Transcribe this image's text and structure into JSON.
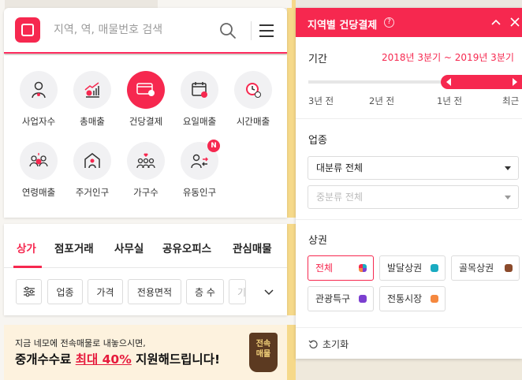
{
  "search": {
    "placeholder": "지역, 역, 매물번호 검색"
  },
  "categories": [
    {
      "label": "사업자수",
      "icon": "person-icon"
    },
    {
      "label": "총매출",
      "icon": "sales-chart-icon"
    },
    {
      "label": "건당결제",
      "icon": "card-payment-icon"
    },
    {
      "label": "요일매출",
      "icon": "calendar-icon"
    },
    {
      "label": "시간매출",
      "icon": "clock-icon"
    },
    {
      "label": "연령매출",
      "icon": "age-group-icon"
    },
    {
      "label": "주거인구",
      "icon": "house-person-icon"
    },
    {
      "label": "가구수",
      "icon": "household-icon"
    },
    {
      "label": "유동인구",
      "icon": "floating-population-icon",
      "badge": "N"
    }
  ],
  "tabs": [
    "상가",
    "점포거래",
    "사무실",
    "공유오피스",
    "관심매물"
  ],
  "filters": [
    "업종",
    "가격",
    "전용면적",
    "층 수",
    "기"
  ],
  "banner": {
    "line1": "지금 네모에 전속매물로 내놓으시면,",
    "line2_prefix": "중개수수료 ",
    "line2_highlight": "최대 40%",
    "line2_suffix": " 지원해드립니다!",
    "stamp": "전속\n매물"
  },
  "panel": {
    "title": "지역별 건당결제",
    "help": "?",
    "period_label": "기간",
    "period_range": "2018년 3분기 ~ 2019년 3분기",
    "ticks": [
      "3년 전",
      "2년 전",
      "1년 전",
      "최근"
    ],
    "industry_label": "업종",
    "industry_major": "대분류 전체",
    "industry_minor": "중분류 전체",
    "district_label": "상권",
    "districts": [
      {
        "label": "전체",
        "color": "multi"
      },
      {
        "label": "발달상권",
        "color": "#1aabc1"
      },
      {
        "label": "골목상권",
        "color": "#8b4a2b"
      },
      {
        "label": "관광특구",
        "color": "#7b3fd0"
      },
      {
        "label": "전통시장",
        "color": "#f5883f"
      }
    ],
    "reset_label": "초기화"
  },
  "colors": {
    "accent": "#f6284f"
  }
}
